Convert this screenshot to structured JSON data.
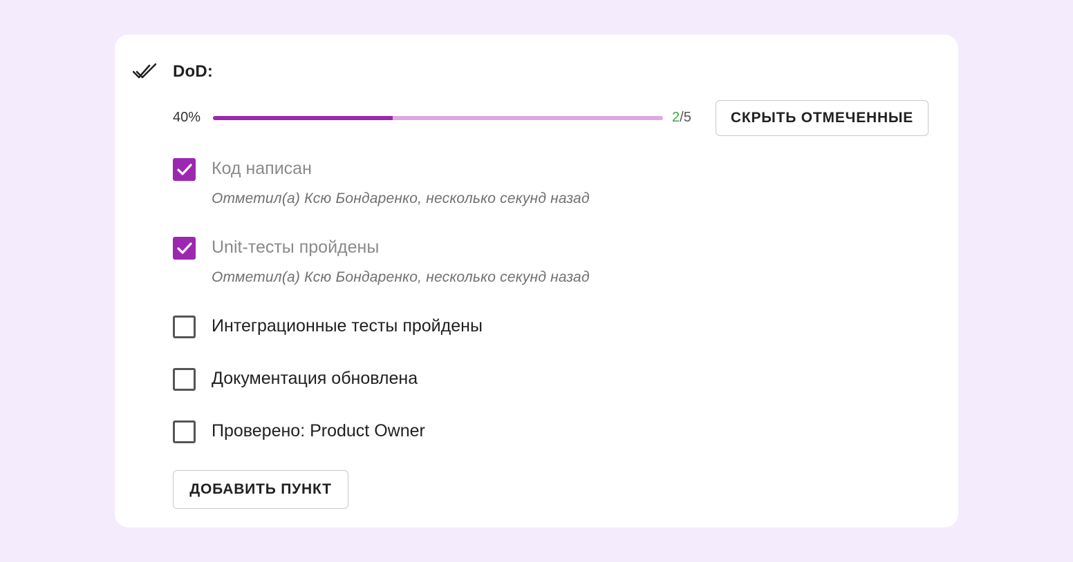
{
  "colors": {
    "page_background": "#f4ebfd",
    "accent": "#9c27b0",
    "track": "#dcaadf",
    "done_count": "#3aa845"
  },
  "header": {
    "icon": "double-check-icon",
    "title": "DoD:"
  },
  "progress": {
    "percent_label": "40%",
    "fraction": 0.4,
    "done": "2",
    "separator": "/",
    "total": "5"
  },
  "toolbar": {
    "hide_checked_label": "СКРЫТЬ ОТМЕЧЕННЫЕ"
  },
  "items": [
    {
      "label": "Код написан",
      "checked": true,
      "meta": "Отметил(а) Ксю Бондаренко, несколько секунд назад"
    },
    {
      "label": "Unit-тесты пройдены",
      "checked": true,
      "meta": "Отметил(а) Ксю Бондаренко, несколько секунд назад"
    },
    {
      "label": "Интеграционные тесты пройдены",
      "checked": false
    },
    {
      "label": "Документация обновлена",
      "checked": false
    },
    {
      "label": "Проверено: Product Owner",
      "checked": false
    }
  ],
  "actions": {
    "add_item_label": "ДОБАВИТЬ ПУНКТ"
  }
}
